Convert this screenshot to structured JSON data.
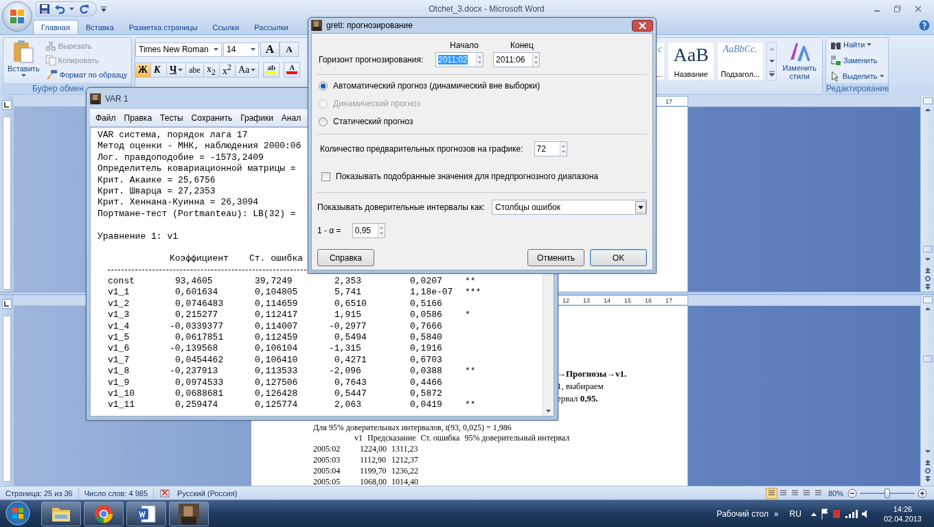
{
  "word": {
    "title": "Otchet_3.docx - Microsoft Word",
    "tabs": [
      {
        "label": "Главная",
        "selected": true
      },
      {
        "label": "Вставка",
        "selected": false
      },
      {
        "label": "Разметка страницы",
        "selected": false
      },
      {
        "label": "Ссылки",
        "selected": false
      },
      {
        "label": "Рассылки",
        "selected": false
      }
    ],
    "clipboard": {
      "paste": "Вставить",
      "group": "Буфер обмен",
      "items": [
        {
          "label": "Вырезать",
          "kind": "cut",
          "disabled": true
        },
        {
          "label": "Копировать",
          "kind": "copy",
          "disabled": true
        },
        {
          "label": "Формат по образцу",
          "kind": "painter",
          "disabled": false
        }
      ]
    },
    "font": {
      "name": "Times New Roman",
      "size": "14",
      "size_buttons": [
        {
          "label": "A",
          "kind": "grow"
        },
        {
          "label": "A",
          "kind": "shrink"
        }
      ],
      "format_buttons": [
        {
          "label": "Ж",
          "kind": "bold",
          "selected": true,
          "menu": false
        },
        {
          "label": "К",
          "kind": "italic",
          "selected": false,
          "menu": false
        },
        {
          "label": "Ч",
          "kind": "underline",
          "selected": false,
          "menu": true
        },
        {
          "label": "abe",
          "kind": "strike",
          "selected": false,
          "menu": false
        },
        {
          "label": "x$_{2}$",
          "kind": "script",
          "selected": false,
          "menu": false
        },
        {
          "label": "x$^{2}$",
          "kind": "script",
          "selected": false,
          "menu": false
        },
        {
          "label": "Aa",
          "kind": "case",
          "selected": false,
          "menu": true
        }
      ],
      "highlight": "ab",
      "font_color": "A"
    },
    "styles": [
      {
        "sample": "c",
        "name": "...",
        "kind": "partial"
      },
      {
        "sample": "AaB",
        "name": "Название",
        "kind": "title"
      },
      {
        "sample": "AaBbCc.",
        "name": "Подзагол...",
        "kind": "subtitle"
      }
    ],
    "change_styles": "Изменить стили",
    "editing": {
      "group": "Редактирование",
      "items": [
        {
          "label": "Найти",
          "kind": "find",
          "menu": true
        },
        {
          "label": "Заменить",
          "kind": "replace",
          "menu": false
        },
        {
          "label": "Выделить",
          "kind": "select",
          "menu": true
        }
      ]
    }
  },
  "panes": [
    {
      "ruler": [
        "17"
      ]
    },
    {
      "ruler": [
        "12",
        "13",
        "14",
        "15",
        "16",
        "17"
      ],
      "fragments": [
        {
          "text": "→Прогнозы→v1.",
          "bold": true
        },
        {
          "text": "1, выбираем",
          "bold": false
        },
        {
          "text": "ервал **0,95.**",
          "bold": false
        }
      ],
      "note": "Для 95% доверительных интервалов, t(93, 0,025) = 1,986",
      "table_header": [
        "v1",
        "Предсказание",
        "Ст. ошибка",
        "95% доверительный интервал"
      ],
      "table_rows": [
        [
          "2005:02",
          "1224,00",
          "1311,23"
        ],
        [
          "2005:03",
          "1112,90",
          "1212,37"
        ],
        [
          "2005:04",
          "1199,70",
          "1236,22"
        ],
        [
          "2005:05",
          "1068,00",
          "1014,40"
        ]
      ]
    }
  ],
  "status": {
    "page": "Страница: 25 из 36",
    "words": "Число слов: 4 985",
    "language": "Русский (Россия)",
    "views": [
      {
        "selected": true
      },
      {
        "selected": false
      },
      {
        "selected": false
      },
      {
        "selected": false
      },
      {
        "selected": false
      }
    ],
    "zoom": "80%",
    "zoom_slider": {
      "level": 0.5
    }
  },
  "taskbar": {
    "apps": [
      {
        "kind": "explorer"
      },
      {
        "kind": "chrome"
      },
      {
        "kind": "word"
      },
      {
        "kind": "gretl"
      }
    ],
    "desktop": "Рабочий стол",
    "more": "»",
    "lang": "RU",
    "time": "14:26",
    "date": "02.04.2013"
  },
  "var_window": {
    "title": "VAR 1",
    "menu": [
      "Файл",
      "Правка",
      "Тесты",
      "Сохранить",
      "Графики",
      "Анал"
    ],
    "summary": [
      "VAR система, порядок лага 17",
      "Метод оценки - МНК, наблюдения 2000:06",
      "Лог. правдоподобие = -1573,2409",
      "Определитель ковариационной матрицы =",
      "Крит. Акаике = 25,6756",
      "Крит. Шварца = 27,2353",
      "Крит. Хеннана-Куинна = 26,3094",
      "Портмане-тест (Portmanteau): LB(32) ="
    ],
    "equation": "Уравнение 1: v1",
    "columns": [
      "Коэффициент",
      "Ст. ошибка"
    ],
    "rows": [
      {
        "name": "const",
        "coef": "93,4605",
        "se": "39,7249",
        "t": "2,353",
        "p": "0,0207",
        "stars": "**"
      },
      {
        "name": "v1_1",
        "coef": "0,601634",
        "se": "0,104805",
        "t": "5,741",
        "p": "1,18e-07",
        "stars": "***"
      },
      {
        "name": "v1_2",
        "coef": "0,0746483",
        "se": "0,114659",
        "t": "0,6510",
        "p": "0,5166",
        "stars": ""
      },
      {
        "name": "v1_3",
        "coef": "0,215277",
        "se": "0,112417",
        "t": "1,915",
        "p": "0,0586",
        "stars": "*"
      },
      {
        "name": "v1_4",
        "coef": "-0,0339377",
        "se": "0,114007",
        "t": "-0,2977",
        "p": "0,7666",
        "stars": ""
      },
      {
        "name": "v1_5",
        "coef": "0,0617851",
        "se": "0,112459",
        "t": "0,5494",
        "p": "0,5840",
        "stars": ""
      },
      {
        "name": "v1_6",
        "coef": "-0,139568",
        "se": "0,106104",
        "t": "-1,315",
        "p": "0,1916",
        "stars": ""
      },
      {
        "name": "v1_7",
        "coef": "0,0454462",
        "se": "0,106410",
        "t": "0,4271",
        "p": "0,6703",
        "stars": ""
      },
      {
        "name": "v1_8",
        "coef": "-0,237913",
        "se": "0,113533",
        "t": "-2,096",
        "p": "0,0388",
        "stars": "**"
      },
      {
        "name": "v1_9",
        "coef": "0,0974533",
        "se": "0,127506",
        "t": "0,7643",
        "p": "0,4466",
        "stars": ""
      },
      {
        "name": "v1_10",
        "coef": "0,0688681",
        "se": "0,126428",
        "t": "0,5447",
        "p": "0,5872",
        "stars": ""
      },
      {
        "name": "v1_11",
        "coef": "0,259474",
        "se": "0,125774",
        "t": "2,063",
        "p": "0,0419",
        "stars": "**"
      }
    ]
  },
  "dialog": {
    "title": "gretl: прогнозирование",
    "horizon_label": "Горизонт прогнозирования:",
    "start": {
      "heading": "Начало",
      "value": "2011:02",
      "highlighted": true
    },
    "end": {
      "heading": "Конец",
      "value": "2011:06",
      "highlighted": false
    },
    "modes": [
      {
        "label": "Автоматический прогноз (динамический вне выборки)",
        "selected": true,
        "disabled": false
      },
      {
        "label": "Динамический прогноз",
        "selected": false,
        "disabled": true
      },
      {
        "label": "Статический прогноз",
        "selected": false,
        "disabled": false
      }
    ],
    "count_label": "Количество предварительных прогнозов на графике:",
    "count": "72",
    "show_fitted": {
      "label": "Показывать подобранные значения для предпрогнозного диапазона",
      "checked": false
    },
    "interval_label": "Показывать доверительные интервалы как:",
    "interval": "Столбцы ошибок",
    "alpha_label": "1 - α =",
    "alpha": "0,95",
    "buttons": [
      {
        "label": "Справка",
        "default": false
      },
      {
        "label": "Отменить",
        "default": false
      },
      {
        "label": "OK",
        "default": true
      }
    ]
  }
}
